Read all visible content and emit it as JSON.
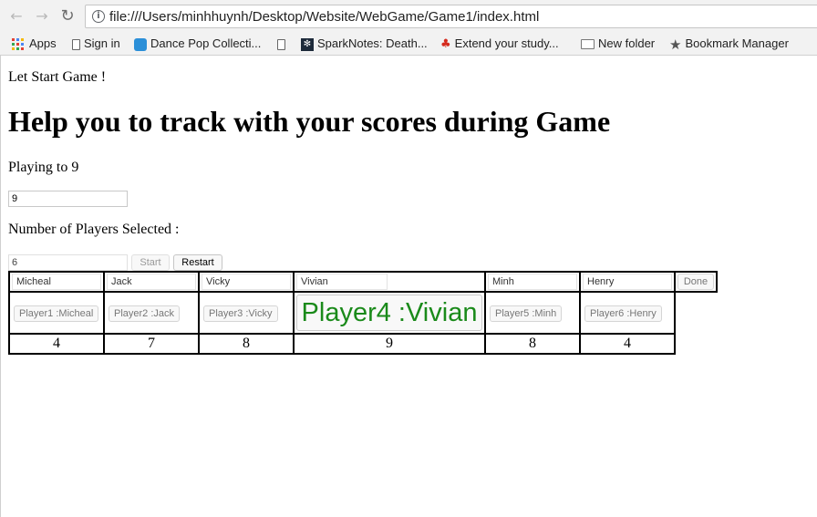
{
  "browser": {
    "url": "file:///Users/minhhuynh/Desktop/Website/WebGame/Game1/index.html",
    "bookmarks": [
      {
        "label": "Apps",
        "icon": "apps-grid-icon"
      },
      {
        "label": "Sign in",
        "icon": "document-icon"
      },
      {
        "label": "Dance Pop Collecti...",
        "icon": "dance-pop-icon"
      },
      {
        "label": "",
        "icon": "document-icon"
      },
      {
        "label": "SparkNotes: Death...",
        "icon": "sparknotes-icon"
      },
      {
        "label": "Extend your study...",
        "icon": "maple-leaf-icon"
      },
      {
        "label": "New folder",
        "icon": "folder-icon"
      },
      {
        "label": "Bookmark Manager",
        "icon": "star-icon"
      }
    ]
  },
  "page": {
    "intro": "Let Start Game !",
    "heading": "Help you to track with your scores during Game",
    "playing_label": "Playing to 9",
    "score_limit_value": "9",
    "players_label": "Number of Players Selected :",
    "players_value": "6",
    "start_label": "Start",
    "restart_label": "Restart",
    "done_label": "Done"
  },
  "players": [
    {
      "name": "Micheal",
      "button": "Player1 :Micheal",
      "score": "4"
    },
    {
      "name": "Jack",
      "button": "Player2 :Jack",
      "score": "7"
    },
    {
      "name": "Vicky",
      "button": "Player3 :Vicky",
      "score": "8"
    },
    {
      "name": "Vivian",
      "button": "Player4 :Vivian",
      "score": "9"
    },
    {
      "name": "Minh",
      "button": "Player5 :Minh",
      "score": "8"
    },
    {
      "name": "Henry",
      "button": "Player6 :Henry",
      "score": "4"
    }
  ],
  "colors": {
    "winner_text": "#1a8a1a"
  }
}
